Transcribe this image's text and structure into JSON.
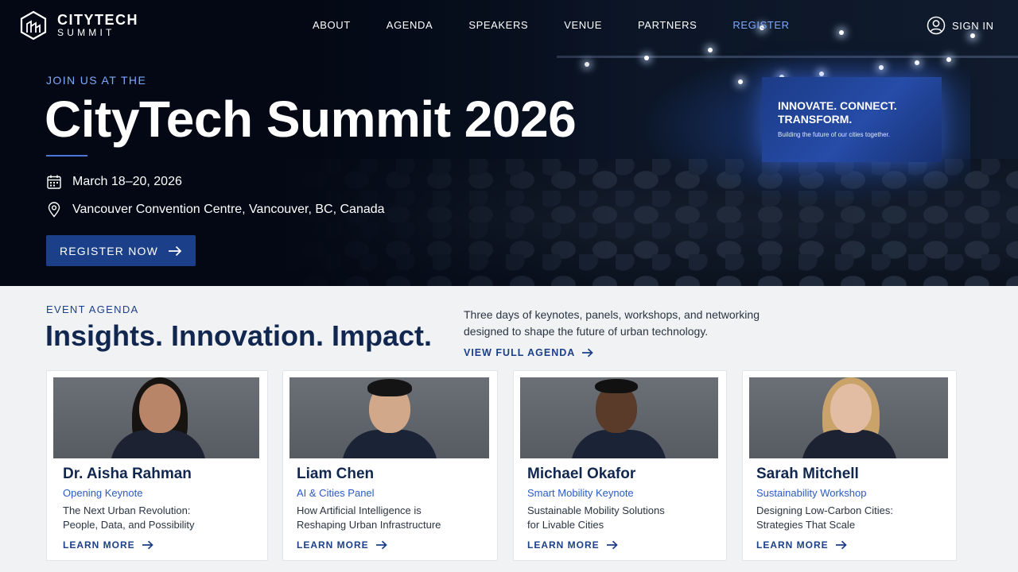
{
  "nav": {
    "logo_title": "CITYTECH",
    "logo_subtitle": "SUMMIT",
    "items": [
      {
        "label": "ABOUT"
      },
      {
        "label": "AGENDA"
      },
      {
        "label": "SPEAKERS"
      },
      {
        "label": "VENUE"
      },
      {
        "label": "PARTNERS"
      },
      {
        "label": "REGISTER"
      }
    ],
    "active_item": "REGISTER",
    "signin_label": "SIGN IN"
  },
  "hero": {
    "kicker": "JOIN US AT THE",
    "title": "CityTech Summit 2026",
    "date": "March 18–20, 2026",
    "location": "Vancouver Convention Centre, Vancouver, BC, Canada",
    "cta_label": "REGISTER NOW",
    "screen_headline": "INNOVATE. CONNECT. TRANSFORM.",
    "screen_tagline": "Building the future of our cities together."
  },
  "agenda": {
    "kicker": "EVENT AGENDA",
    "title": "Insights. Innovation. Impact.",
    "description": "Three days of keynotes, panels, workshops, and networking designed to shape the future of urban technology.",
    "link_label": "VIEW FULL AGENDA"
  },
  "speakers": [
    {
      "name": "Dr. Aisha Rahman",
      "session_type": "Opening Keynote",
      "talk_line1": "The Next Urban Revolution:",
      "talk_line2": "People, Data, and Possibility",
      "link_label": "LEARN MORE"
    },
    {
      "name": "Liam Chen",
      "session_type": "AI & Cities Panel",
      "talk_line1": "How Artificial Intelligence is",
      "talk_line2": "Reshaping Urban Infrastructure",
      "link_label": "LEARN MORE"
    },
    {
      "name": "Michael Okafor",
      "session_type": "Smart Mobility Keynote",
      "talk_line1": "Sustainable Mobility Solutions",
      "talk_line2": "for Livable Cities",
      "link_label": "LEARN MORE"
    },
    {
      "name": "Sarah Mitchell",
      "session_type": "Sustainability Workshop",
      "talk_line1": "Designing Low-Carbon Cities:",
      "talk_line2": "Strategies That Scale",
      "link_label": "LEARN MORE"
    }
  ],
  "colors": {
    "accent": "#1b3f88",
    "link_blue": "#2a5bc4",
    "active_nav": "#7da9ff",
    "hero_bg": "#030814"
  },
  "icons": [
    "logo-icon",
    "user-icon",
    "calendar-icon",
    "location-pin-icon",
    "arrow-right-icon"
  ]
}
